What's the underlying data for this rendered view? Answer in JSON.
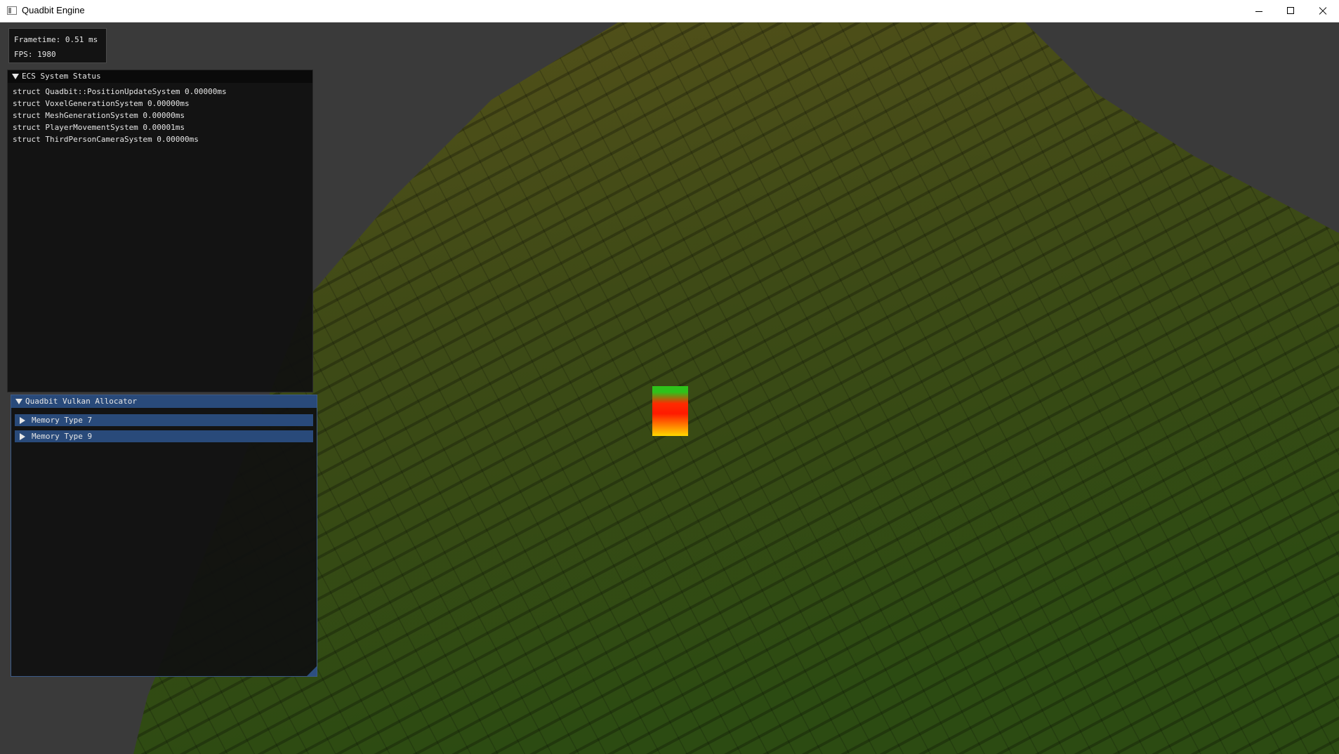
{
  "window": {
    "title": "Quadbit Engine",
    "controls": [
      "minimize",
      "maximize",
      "close"
    ]
  },
  "stats": {
    "frametime": "Frametime: 0.51 ms",
    "fps": "FPS: 1980"
  },
  "ecs_window": {
    "title": "ECS System Status",
    "systems": [
      "struct Quadbit::PositionUpdateSystem 0.00000ms",
      "struct VoxelGenerationSystem 0.00000ms",
      "struct MeshGenerationSystem 0.00000ms",
      "struct PlayerMovementSystem 0.00001ms",
      "struct ThirdPersonCameraSystem 0.00000ms"
    ]
  },
  "allocator_window": {
    "title": "Quadbit Vulkan Allocator",
    "nodes": [
      "Memory Type 7",
      "Memory Type 9"
    ]
  },
  "colors": {
    "terrain_top": "#4a4a12",
    "terrain_bottom": "#2a4a12",
    "header_active": "#294a7a",
    "panel_bg": "#101010"
  }
}
